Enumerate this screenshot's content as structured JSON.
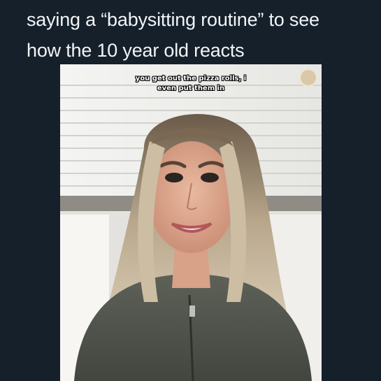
{
  "caption": {
    "line1": "saying a “babysitting routine” to see",
    "line2": "how the 10 year old reacts"
  },
  "video": {
    "subtitle_line1": "you get out the pizza rolls, i",
    "subtitle_line2": "even put them in"
  },
  "colors": {
    "background": "#15202b",
    "caption_text": "#f2f4f6"
  }
}
